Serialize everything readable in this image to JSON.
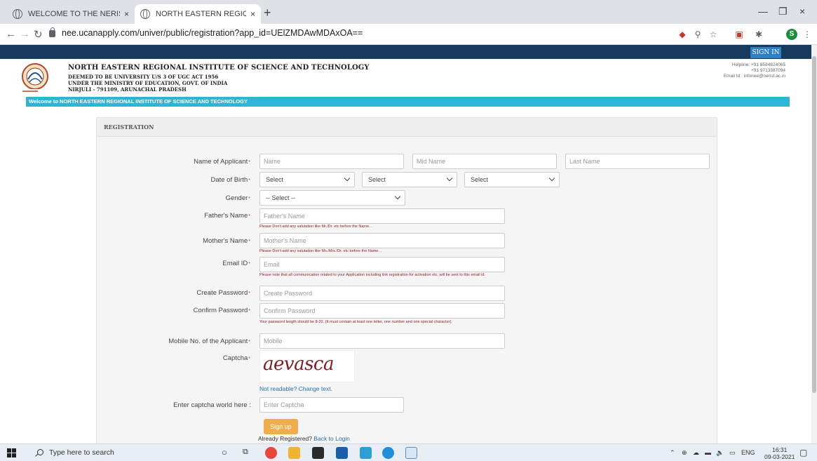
{
  "browser": {
    "tabs": [
      {
        "title": "WELCOME TO THE NERIST WEB",
        "close": "×"
      },
      {
        "title": "NORTH EASTERN REGIONAL INS",
        "close": "×"
      }
    ],
    "new_tab": "+",
    "window": {
      "minimize": "—",
      "maximize": "❐",
      "close": "×"
    },
    "url": "nee.ucanapply.com/univer/public/registration?app_id=UElZMDAwMDAxOA=="
  },
  "header": {
    "signin_label": "SIGN IN",
    "institute_name": "NORTH EASTERN REGIONAL INSTITUTE OF SCIENCE AND TECHNOLOGY",
    "line1": "DEEMED TO BE UNIVERSITY U/S 3 OF UGC ACT 1956",
    "line2": "UNDER THE MINISTRY OF EDUCATION, GOVT. OF INDIA",
    "line3": "NIRJULI - 791109, ARUNACHAL PRADESH",
    "helpline1": "Helpline: +91 8584824065",
    "helpline2": "+91 9713387094",
    "email": "Email Id : infonee@nerist.ac.in",
    "welcome": "Welcome to NORTH EASTERN REGIONAL INSTITUTE OF SCIENCE AND TECHNOLOGY"
  },
  "form": {
    "title": "REGISTRATION",
    "required_mark": "*",
    "labels": {
      "name": "Name of Applicant",
      "dob": "Date of Birth",
      "gender": "Gender",
      "father": "Father's Name",
      "mother": "Mother's Name",
      "email": "Email ID",
      "create_password": "Create Password",
      "confirm_password": "Confirm Password",
      "mobile": "Mobile No. of the Applicant",
      "captcha": "Captcha",
      "enter_captcha": "Enter captcha world here :"
    },
    "placeholders": {
      "first_name": "Name",
      "mid_name": "Mid Name",
      "last_name": "Last Name",
      "father": "Father's Name",
      "mother": "Mother's Name",
      "email": "Email",
      "create_password": "Create Password",
      "confirm_password": "Confirm Password",
      "mobile": "Mobile",
      "captcha": "Enter Captcha"
    },
    "selects": {
      "day": "Select",
      "month": "Select",
      "year": "Select",
      "gender": "-- Select --"
    },
    "hints": {
      "father": "Please Don't add any salutation like Mr./Dr. etc before the Name. .",
      "mother": "Please Don't add any salutation like Ms./Mrs./Dr. etc before the Name. .",
      "email": "Please note that all communication related to your Application including link registration for activation etc. will be sent to this email id.",
      "password": "Your password length should be 8-20. (It must contain at least one letter, one number and one special character)."
    },
    "captcha_text": "aevasca",
    "change_captcha": "Not readable? Change text.",
    "signup_label": "Sign up",
    "already_registered": "Already Registered?",
    "back_to_login": "Back to Login"
  },
  "taskbar": {
    "search_placeholder": "Type here to search",
    "language": "ENG",
    "time": "16:31",
    "date": "09-03-2021"
  },
  "colors": {
    "top_band": "#173a5e",
    "welcome_bar": "#2bb6d8",
    "signup_button": "#f0ad4e",
    "hint_text": "#8b1c1c"
  }
}
